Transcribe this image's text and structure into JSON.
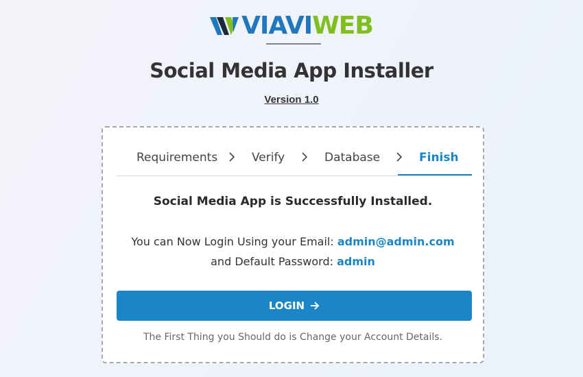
{
  "brand": {
    "logo_via": "VIAVI",
    "logo_web": "WEB",
    "colors": {
      "blue": "#1f77bd",
      "green": "#7fbf1e",
      "dark": "#1b2a3a"
    }
  },
  "header": {
    "title": "Social Media App Installer",
    "version": "Version 1.0"
  },
  "steps": [
    {
      "label": "Requirements",
      "active": false
    },
    {
      "label": "Verify",
      "active": false
    },
    {
      "label": "Database",
      "active": false
    },
    {
      "label": "Finish",
      "active": true
    }
  ],
  "content": {
    "success_message": "Social Media App is Successfully Installed.",
    "email_prefix": "You can Now Login Using your Email:",
    "email": "admin@admin.com",
    "password_prefix": "and Default Password:",
    "password": "admin",
    "login_label": "LOGIN",
    "note": "The First Thing you Should do is Change your Account Details."
  },
  "icons": {
    "step_separator": "chevron-right-icon",
    "login_arrow": "arrow-right-icon"
  },
  "theme": {
    "accent": "#1a86c8"
  }
}
